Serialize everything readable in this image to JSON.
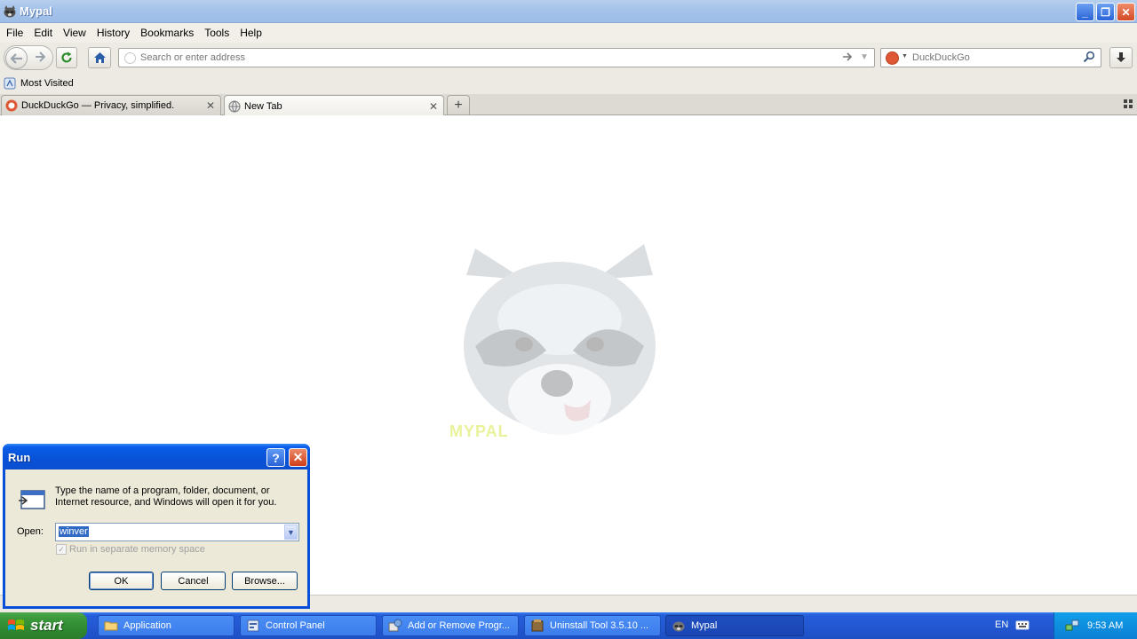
{
  "window": {
    "title": "Mypal",
    "controls": {
      "minimize": "_",
      "maximize": "❐",
      "close": "✕"
    }
  },
  "menubar": {
    "items": [
      "File",
      "Edit",
      "View",
      "History",
      "Bookmarks",
      "Tools",
      "Help"
    ]
  },
  "navbar": {
    "address_placeholder": "Search or enter address",
    "address_value": "",
    "search_engine": "DuckDuckGo",
    "search_placeholder": "DuckDuckGo",
    "icons": [
      "back-icon",
      "forward-icon",
      "reload-icon",
      "home-icon",
      "go-icon",
      "search-icon",
      "download-icon"
    ]
  },
  "bookmarks": {
    "items": [
      {
        "label": "Most Visited",
        "icon": "most-visited-icon"
      }
    ]
  },
  "tabs": {
    "items": [
      {
        "label": "DuckDuckGo — Privacy, simplified.",
        "icon": "duckduckgo-icon",
        "active": false
      },
      {
        "label": "New Tab",
        "icon": "globe-icon",
        "active": true
      }
    ],
    "new_tab": "+"
  },
  "content": {
    "logo_text": "MYPAL"
  },
  "run_dialog": {
    "title": "Run",
    "help": "?",
    "description": "Type the name of a program, folder, document, or Internet resource, and Windows will open it for you.",
    "open_label": "Open:",
    "open_value": "winver",
    "checkbox_label": "Run in separate memory space",
    "checkbox_checked": true,
    "ok": "OK",
    "cancel": "Cancel",
    "browse": "Browse..."
  },
  "taskbar": {
    "start": "start",
    "buttons": [
      {
        "label": "Application",
        "icon": "folder-icon",
        "active": false
      },
      {
        "label": "Control Panel",
        "icon": "control-panel-icon",
        "active": false
      },
      {
        "label": "Add or Remove Progr...",
        "icon": "add-remove-programs-icon",
        "active": false
      },
      {
        "label": "Uninstall Tool 3.5.10 ...",
        "icon": "uninstall-tool-icon",
        "active": false
      },
      {
        "label": "Mypal",
        "icon": "mypal-icon",
        "active": true
      }
    ],
    "language": "EN",
    "clock": "9:53 AM"
  },
  "colors": {
    "xp_blue": "#245edb",
    "start_green": "#3c9a3c",
    "tray_blue": "#129fe9",
    "chrome_bg": "#eceae2"
  }
}
